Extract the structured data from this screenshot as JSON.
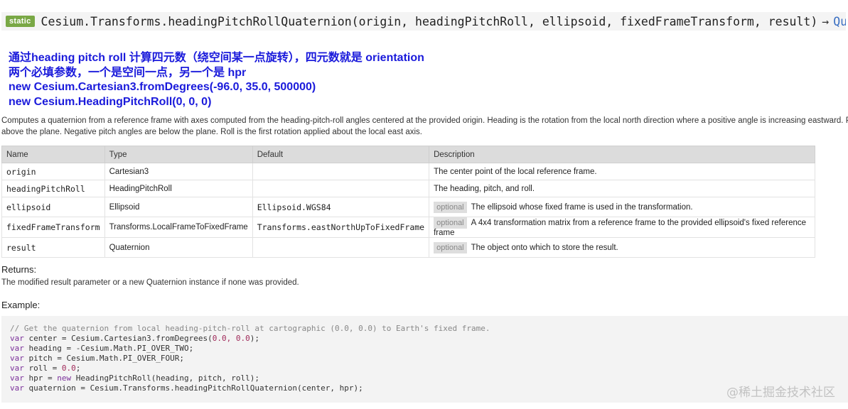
{
  "signature": {
    "badge": "static",
    "text": "Cesium.Transforms.headingPitchRollQuaternion(origin, headingPitchRoll, ellipsoid, fixedFrameTransform, result)",
    "arrow": "→",
    "return_type": "Quaternion"
  },
  "notes": [
    "通过heading pitch roll 计算四元数（绕空间某一点旋转），四元数就是 orientation",
    "两个必填参数，一个是空间一点，另一个是 hpr",
    "new Cesium.Cartesian3.fromDegrees(-96.0, 35.0, 500000)",
    "new Cesium.HeadingPitchRoll(0, 0, 0)"
  ],
  "description": {
    "line1": "Computes a quaternion from a reference frame with axes computed from the heading-pitch-roll angles centered at the provided origin. Heading is the rotation from the local north direction where a positive angle is increasing eastward. Pitch",
    "line2": "above the plane. Negative pitch angles are below the plane. Roll is the first rotation applied about the local east axis."
  },
  "params": {
    "headers": {
      "name": "Name",
      "type": "Type",
      "default": "Default",
      "description": "Description"
    },
    "optional_label": "optional",
    "rows": [
      {
        "name": "origin",
        "type": "Cartesian3",
        "default": "",
        "optional": "",
        "description": "The center point of the local reference frame."
      },
      {
        "name": "headingPitchRoll",
        "type": "HeadingPitchRoll",
        "default": "",
        "optional": "",
        "description": "The heading, pitch, and roll."
      },
      {
        "name": "ellipsoid",
        "type": "Ellipsoid",
        "default": "Ellipsoid.WGS84",
        "optional": "optional",
        "description": "The ellipsoid whose fixed frame is used in the transformation."
      },
      {
        "name": "fixedFrameTransform",
        "type": "Transforms.LocalFrameToFixedFrame",
        "default": "Transforms.eastNorthUpToFixedFrame",
        "optional": "optional",
        "description": "A 4x4 transformation matrix from a reference frame to the provided ellipsoid's fixed reference frame"
      },
      {
        "name": "result",
        "type": "Quaternion",
        "default": "",
        "optional": "optional",
        "description": "The object onto which to store the result."
      }
    ]
  },
  "returns": {
    "heading": "Returns:",
    "text": "The modified result parameter or a new Quaternion instance if none was provided."
  },
  "example": {
    "heading": "Example:",
    "comment": "// Get the quaternion from local heading-pitch-roll at cartographic (0.0, 0.0) to Earth's fixed frame.",
    "lines": [
      {
        "kw": "var",
        "rest": " center = Cesium.Cartesian3.fromDegrees(",
        "num": "0.0, 0.0",
        "tail": ");"
      },
      {
        "kw": "var",
        "rest": " heading = -Cesium.Math.PI_OVER_TWO;",
        "num": "",
        "tail": ""
      },
      {
        "kw": "var",
        "rest": " pitch = Cesium.Math.PI_OVER_FOUR;",
        "num": "",
        "tail": ""
      },
      {
        "kw": "var",
        "rest": " roll = ",
        "num": "0.0",
        "tail": ";"
      },
      {
        "kw": "var",
        "rest": " hpr = ",
        "num": "",
        "tail": ""
      },
      {
        "kw": "var",
        "rest": " quaternion = Cesium.Transforms.headingPitchRollQuaternion(center, hpr);",
        "num": "",
        "tail": ""
      }
    ],
    "hpr_new": "new",
    "hpr_rest": " HeadingPitchRoll(heading, pitch, roll);"
  },
  "watermark": "@稀土掘金技术社区"
}
